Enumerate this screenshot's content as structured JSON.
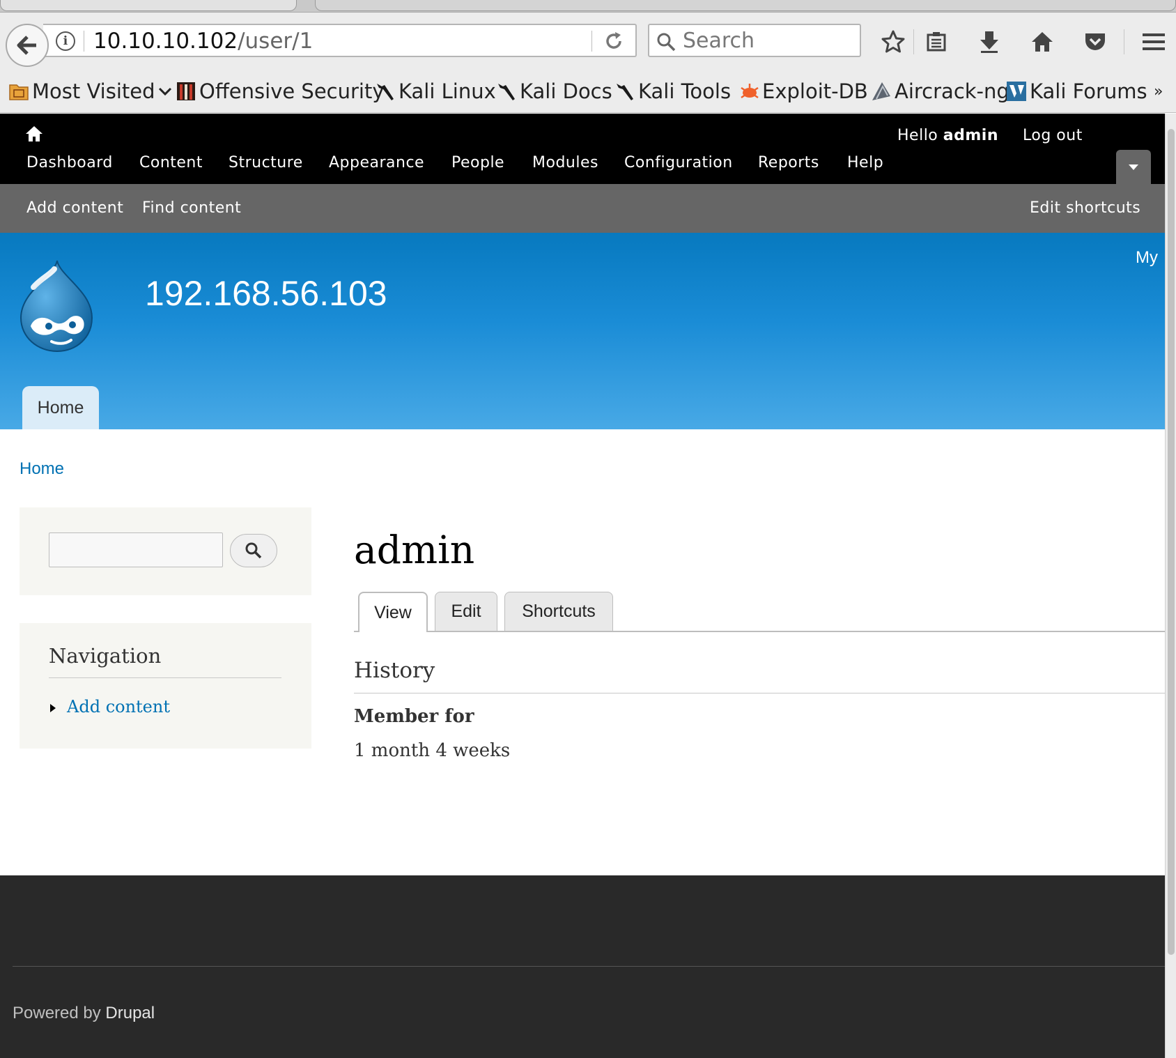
{
  "browser": {
    "url_host": "10.10.10.102",
    "url_path": "/user/1",
    "search_placeholder": "Search",
    "info_glyph": "i",
    "toolbar_icons": [
      "star-icon",
      "reading-list-icon",
      "download-icon",
      "home-icon",
      "pocket-icon",
      "menu-icon"
    ],
    "bookmarks": [
      {
        "label": "Most Visited",
        "icon": "folder-icon"
      },
      {
        "label": "Offensive Security",
        "icon": "offsec-icon"
      },
      {
        "label": "Kali Linux",
        "icon": "kali-dragon-icon"
      },
      {
        "label": "Kali Docs",
        "icon": "kali-dragon-icon"
      },
      {
        "label": "Kali Tools",
        "icon": "kali-dragon-icon"
      },
      {
        "label": "Exploit-DB",
        "icon": "exploitdb-icon"
      },
      {
        "label": "Aircrack-ng",
        "icon": "aircrack-icon"
      },
      {
        "label": "Kali Forums",
        "icon": "kali-forums-icon"
      }
    ],
    "overflow": "»"
  },
  "toolbar": {
    "menu": [
      "Dashboard",
      "Content",
      "Structure",
      "Appearance",
      "People",
      "Modules",
      "Configuration",
      "Reports",
      "Help"
    ],
    "hello_prefix": "Hello ",
    "username": "admin",
    "logout": "Log out",
    "shortcuts": [
      "Add content",
      "Find content"
    ],
    "edit_shortcuts": "Edit shortcuts"
  },
  "header": {
    "site_name": "192.168.56.103",
    "secondary_menu_partial": "My",
    "main_tab": "Home",
    "brand_color": "#0779bf"
  },
  "breadcrumb": "Home",
  "sidebar": {
    "search_value": "",
    "navigation_title": "Navigation",
    "navigation_items": [
      "Add content"
    ]
  },
  "main": {
    "title": "admin",
    "tabs": [
      "View",
      "Edit",
      "Shortcuts"
    ],
    "active_tab": "View",
    "history_title": "History",
    "member_label": "Member for",
    "member_value": "1 month 4 weeks"
  },
  "footer": {
    "powered_prefix": "Powered by ",
    "powered_link": "Drupal"
  }
}
